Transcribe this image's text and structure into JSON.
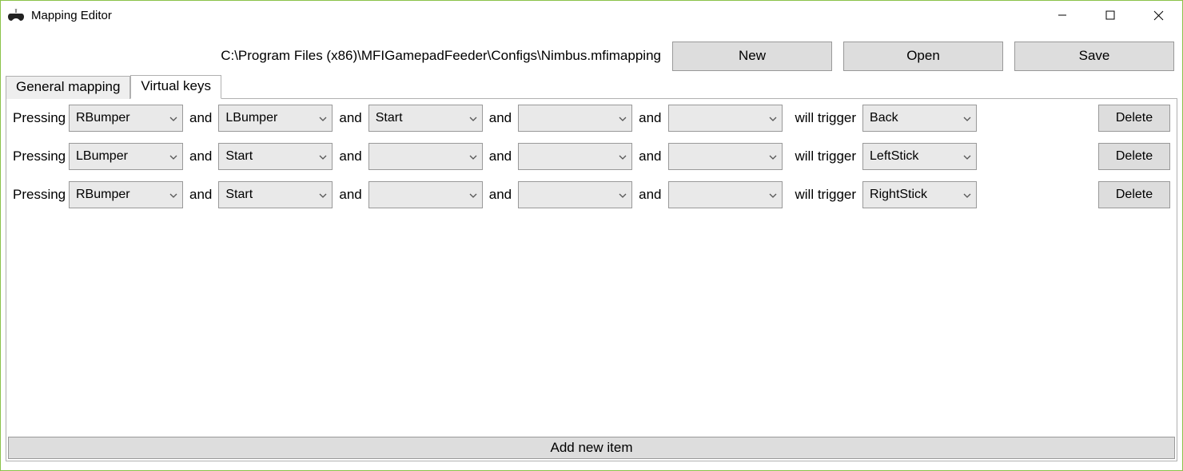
{
  "window": {
    "title": "Mapping Editor"
  },
  "toolbar": {
    "path": "C:\\Program Files (x86)\\MFIGamepadFeeder\\Configs\\Nimbus.mfimapping",
    "new_label": "New",
    "open_label": "Open",
    "save_label": "Save"
  },
  "tabs": {
    "general": "General mapping",
    "virtual": "Virtual keys",
    "active_index": 1
  },
  "labels": {
    "pressing": "Pressing",
    "and": "and",
    "will_trigger": "will trigger",
    "delete": "Delete",
    "add_new": "Add new item"
  },
  "rows": [
    {
      "inputs": [
        "RBumper",
        "LBumper",
        "Start",
        "",
        ""
      ],
      "output": "Back"
    },
    {
      "inputs": [
        "LBumper",
        "Start",
        "",
        "",
        ""
      ],
      "output": "LeftStick"
    },
    {
      "inputs": [
        "RBumper",
        "Start",
        "",
        "",
        ""
      ],
      "output": "RightStick"
    }
  ]
}
